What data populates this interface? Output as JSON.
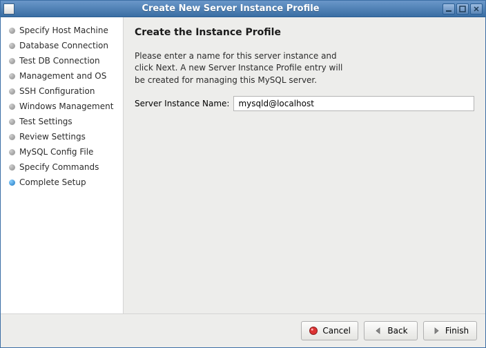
{
  "window": {
    "title": "Create New Server Instance Profile"
  },
  "sidebar": {
    "steps": [
      {
        "label": "Specify Host Machine",
        "active": false
      },
      {
        "label": "Database Connection",
        "active": false
      },
      {
        "label": "Test DB Connection",
        "active": false
      },
      {
        "label": "Management and OS",
        "active": false
      },
      {
        "label": "SSH Configuration",
        "active": false
      },
      {
        "label": "Windows Management",
        "active": false
      },
      {
        "label": "Test Settings",
        "active": false
      },
      {
        "label": "Review Settings",
        "active": false
      },
      {
        "label": "MySQL Config File",
        "active": false
      },
      {
        "label": "Specify Commands",
        "active": false
      },
      {
        "label": "Complete Setup",
        "active": true
      }
    ]
  },
  "main": {
    "heading": "Create the Instance Profile",
    "instructions": "Please enter a name for this server instance and click Next. A new Server Instance Profile entry will be created for managing this MySQL server.",
    "input_label": "Server Instance Name:",
    "input_value": "mysqld@localhost"
  },
  "footer": {
    "cancel": "Cancel",
    "back": "Back",
    "finish": "Finish"
  }
}
